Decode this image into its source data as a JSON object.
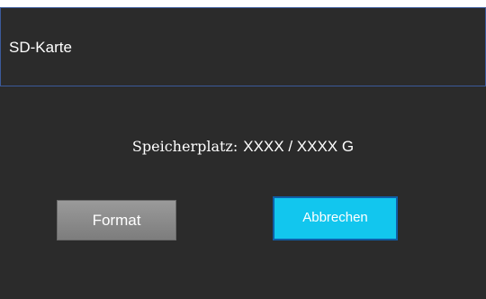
{
  "dialog": {
    "title": "SD-Karte",
    "storage_label": "Speicherplatz:",
    "storage_value": "XXXX / XXXX G"
  },
  "buttons": {
    "format_label": "Format",
    "cancel_label": "Abbrechen"
  },
  "colors": {
    "background": "#2b2b2b",
    "header_border": "#3b5a9a",
    "format_button": "#8c8c8c",
    "cancel_button": "#12c6ee",
    "cancel_border": "#0e5ea8",
    "text": "#ffffff"
  }
}
